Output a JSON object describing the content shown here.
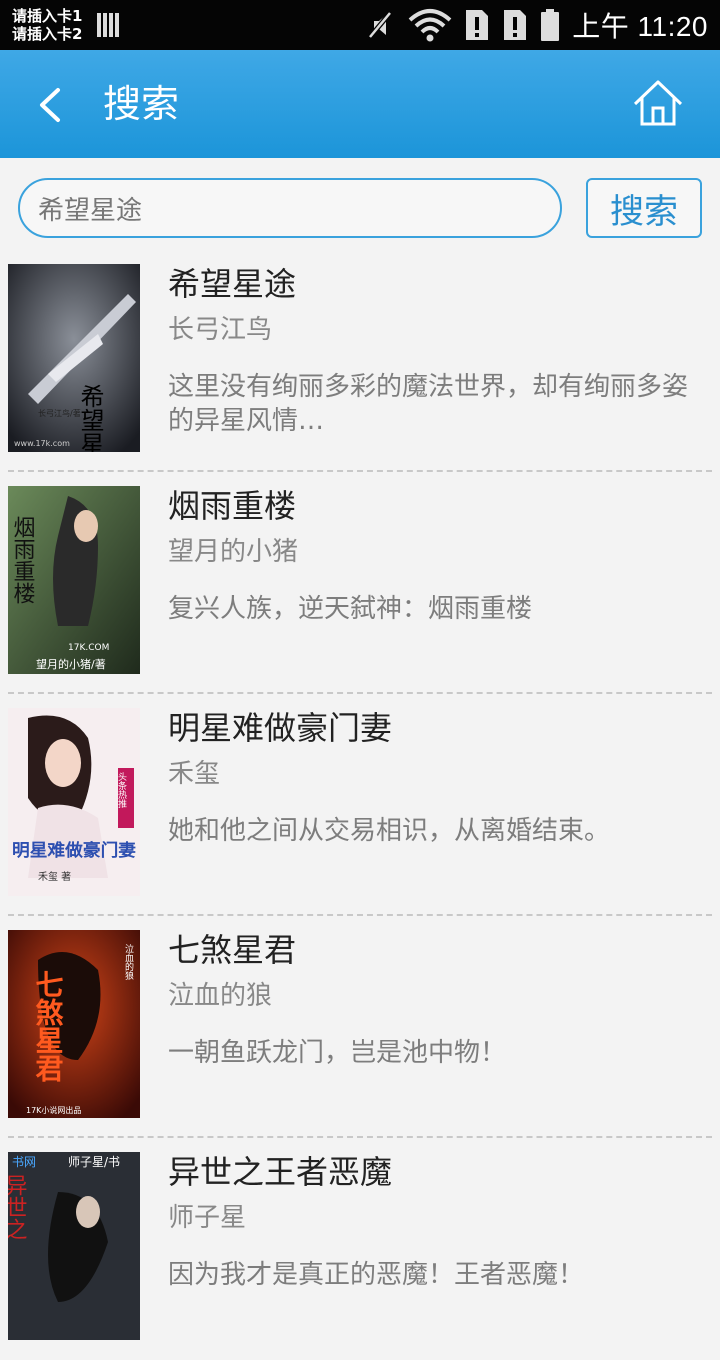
{
  "status_bar": {
    "sim1": "请插入卡1",
    "sim2": "请插入卡2",
    "time": "上午 11:20"
  },
  "header": {
    "title": "搜索"
  },
  "search": {
    "value": "希望星途",
    "button_label": "搜索"
  },
  "books": [
    {
      "title": "希望星途",
      "author": "长弓江鸟",
      "description": "这里没有绚丽多彩的魔法世界，却有绚丽多姿的异星风情…",
      "cover_text": "希望星途",
      "cover_sub": "长弓江鸟/著",
      "cover_mark": "www.17k.com"
    },
    {
      "title": "烟雨重楼",
      "author": "望月的小猪",
      "description": "复兴人族，逆天弑神：烟雨重楼",
      "cover_text": "烟雨重楼",
      "cover_sub": "望月的小猪/著",
      "cover_mark": "17K.COM"
    },
    {
      "title": "明星难做豪门妻",
      "author": "禾玺",
      "description": "她和他之间从交易相识，从离婚结束。",
      "cover_text": "明星难做豪门妻",
      "cover_sub": "禾玺 著",
      "cover_mark": "头条热推"
    },
    {
      "title": "七煞星君",
      "author": "泣血的狼",
      "description": "一朝鱼跃龙门，岂是池中物！",
      "cover_text": "七煞星君",
      "cover_sub": "泣血的狼",
      "cover_mark": "17K小说网出品"
    },
    {
      "title": "异世之王者恶魔",
      "author": "师子星",
      "description": "因为我才是真正的恶魔！王者恶魔！",
      "cover_text": "异世之",
      "cover_sub": "师子星/书",
      "cover_mark": "书网"
    }
  ]
}
